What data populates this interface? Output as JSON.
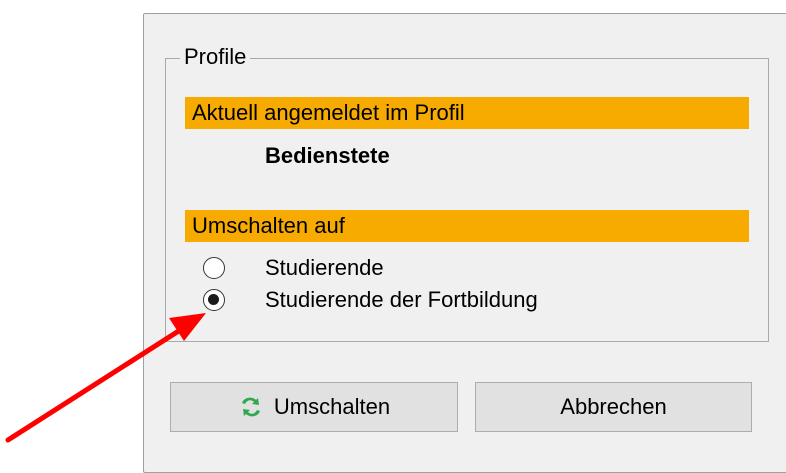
{
  "groupbox": {
    "title": "Profile"
  },
  "current": {
    "header": "Aktuell angemeldet im Profil",
    "profile": "Bedienstete"
  },
  "switch_to": {
    "header": "Umschalten auf",
    "options": [
      {
        "label": "Studierende",
        "selected": false
      },
      {
        "label": "Studierende der Fortbildung",
        "selected": true
      }
    ]
  },
  "buttons": {
    "switch_label": "Umschalten",
    "cancel_label": "Abbrechen"
  },
  "colors": {
    "highlight": "#f7ab00",
    "arrow": "#ff0000",
    "switch_icon": "#2fa84f"
  },
  "icons": {
    "switch": "switch-arrows-icon"
  }
}
